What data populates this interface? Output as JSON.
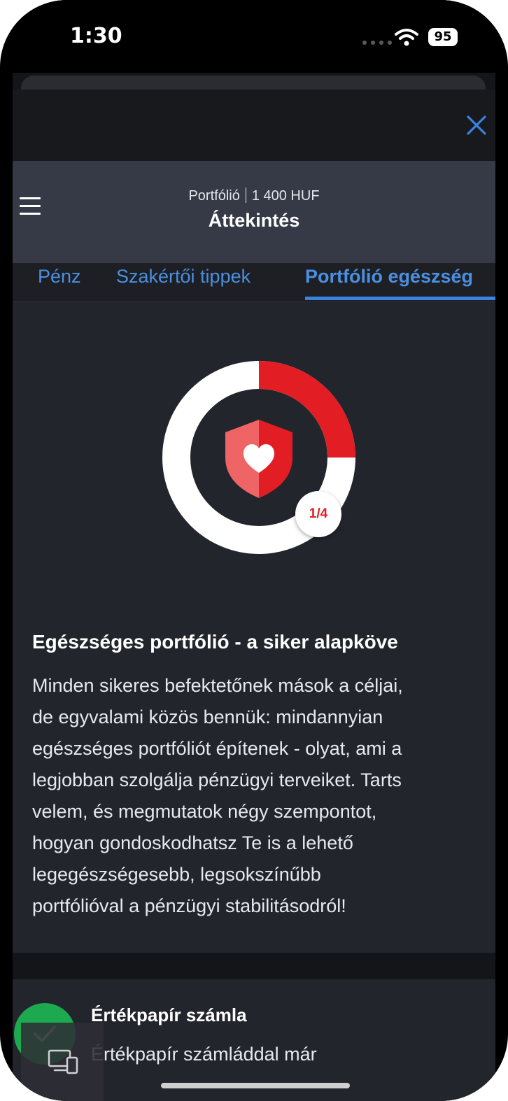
{
  "status_bar": {
    "time": "1:30",
    "battery": "95"
  },
  "header": {
    "portfolio_label": "Portfólió",
    "portfolio_value": "1 400 HUF",
    "title": "Áttekintés"
  },
  "tabs": [
    {
      "label": "Pénz"
    },
    {
      "label": "Szakértői tippek"
    },
    {
      "label": "Portfólió egészség"
    }
  ],
  "health": {
    "progress_label": "1/4",
    "completed_steps": 1,
    "total_steps": 4,
    "colors": {
      "ring_filled": "#e21e24",
      "ring_empty": "#ffffff",
      "shield_light": "#ef6464",
      "shield_dark": "#e21e24"
    }
  },
  "article": {
    "title": "Egészséges portfólió - a siker alapköve",
    "body_lines": [
      "Minden sikeres befektetőnek mások a céljai,",
      "de egyvalami közös bennük: mindannyian",
      "egészséges portfóliót építenek - olyat, ami a",
      "legjobban szolgálja pénzügyi terveiket. Tarts",
      "velem, és megmutatok négy szempontot,",
      "hogyan gondoskodhatsz Te is a lehető",
      "legegészségesebb, legsokszínűbb",
      "portfólióval a pénzügyi stabilitásodról!"
    ]
  },
  "card": {
    "title": "Értékpapír számla",
    "body": "Értékpapír számláddal már"
  },
  "colors": {
    "accent": "#3b82e0",
    "check_button": "#1db954"
  }
}
